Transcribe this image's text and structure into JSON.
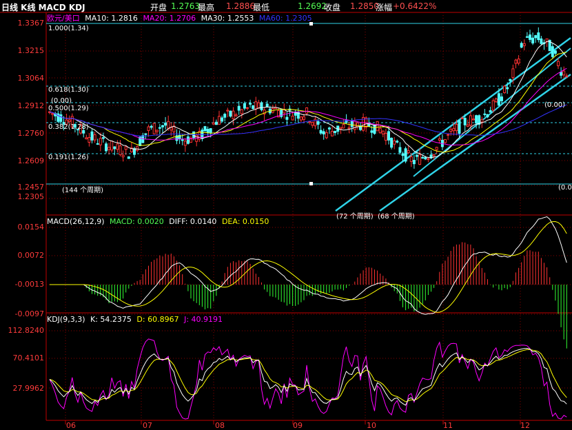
{
  "header": {
    "title": "日线 K线 MACD KDJ",
    "open_label": "开盘",
    "open_value": "1.2763",
    "high_label": "最高",
    "high_value": "1.2886",
    "low_label": "最低",
    "low_value": "1.2692",
    "close_label": "收盘",
    "close_value": "1.2850",
    "change_label": "涨幅",
    "change_value": "+0.6422%"
  },
  "price_panel": {
    "symbol": "欧元/美口",
    "ma10": "MA10: 1.2816",
    "ma20": "MA20: 1.2706",
    "ma30": "MA30: 1.2553",
    "ma60": "MA60: 1.2305",
    "y_ticks": [
      "1.3367",
      "1.3215",
      "1.3064",
      "1.2912",
      "1.2760",
      "1.2609",
      "1.2457",
      "1.2305"
    ],
    "fib_labels": [
      "1.000(1.34)",
      "0.618(1.30)",
      "(0.00)",
      "0.500(1.29)",
      "0.382(1.28)",
      "0.191(1.26)"
    ],
    "period_labels": [
      "(144 个周期)",
      "(0.00)",
      "(0.0",
      "(72 个周期)",
      "(68 个周期)"
    ],
    "period_top": "(144 个周期)"
  },
  "macd_panel": {
    "params": "MACD(26,12,9)",
    "macd": "MACD: 0.0020",
    "diff": "DIFF: 0.0140",
    "dea": "DEA: 0.0150",
    "y_ticks": [
      "0.0154",
      "0.0072",
      "-0.0013",
      "-0.0097"
    ]
  },
  "kdj_panel": {
    "params": "KDJ(9,3,3)",
    "k": "K: 54.2375",
    "d": "D: 60.8967",
    "j": "J: 40.9191",
    "y_ticks": [
      "112.8240",
      "70.4101",
      "27.9962"
    ]
  },
  "x_axis": [
    "06",
    "07",
    "08",
    "09",
    "10",
    "11",
    "12"
  ],
  "colors": {
    "up": "#ff3232",
    "down": "#54ffff",
    "axis": "#c00000",
    "ma10": "#ffffff",
    "ma20": "#ffff00",
    "ma30": "#ff00ff",
    "ma60": "#3333ff",
    "trend": "#2fd3e8",
    "diff": "#ffffff",
    "dea": "#ffff00",
    "k": "#ffffff",
    "d": "#ffff00",
    "j": "#ff00ff"
  }
}
